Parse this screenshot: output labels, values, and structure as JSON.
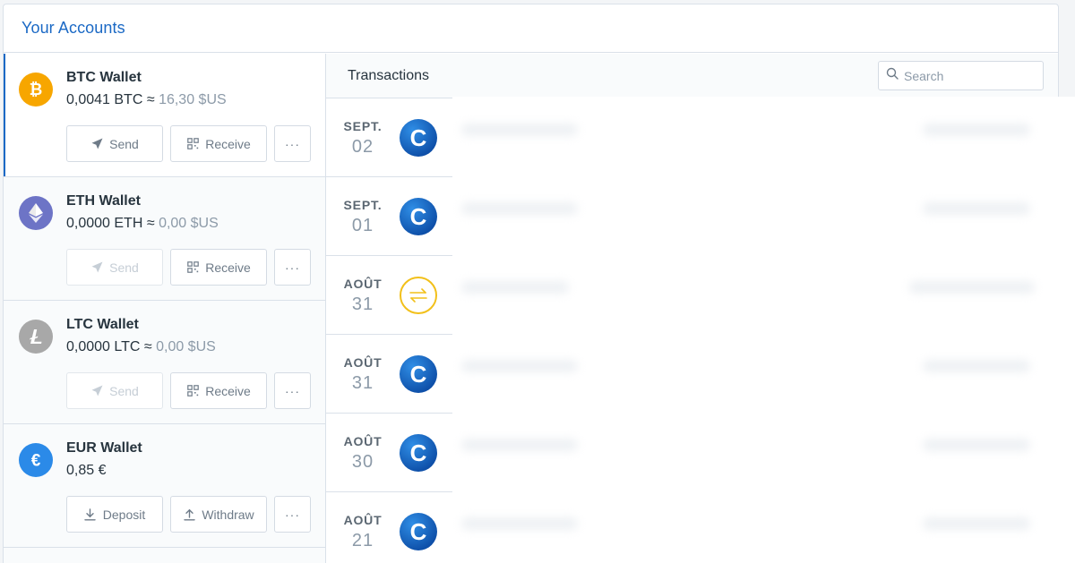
{
  "panel": {
    "title": "Your Accounts"
  },
  "accounts": [
    {
      "name": "BTC Wallet",
      "amount": "0,0041 BTC ≈ ",
      "fiat": "16,30 $US",
      "icon": "bitcoin-icon",
      "color": "#f7a600",
      "actions": [
        {
          "label": "Send",
          "icon": "send-icon",
          "disabled": false
        },
        {
          "label": "Receive",
          "icon": "qr-code-icon",
          "disabled": false
        }
      ]
    },
    {
      "name": "ETH Wallet",
      "amount": "0,0000 ETH ≈ ",
      "fiat": "0,00 $US",
      "icon": "ethereum-icon",
      "color": "#6d74c6",
      "actions": [
        {
          "label": "Send",
          "icon": "send-icon",
          "disabled": true
        },
        {
          "label": "Receive",
          "icon": "qr-code-icon",
          "disabled": false
        }
      ]
    },
    {
      "name": "LTC Wallet",
      "amount": "0,0000 LTC ≈ ",
      "fiat": "0,00 $US",
      "icon": "litecoin-icon",
      "color": "#a8a8a8",
      "actions": [
        {
          "label": "Send",
          "icon": "send-icon",
          "disabled": true
        },
        {
          "label": "Receive",
          "icon": "qr-code-icon",
          "disabled": false
        }
      ]
    },
    {
      "name": "EUR Wallet",
      "amount": "0,85 €",
      "fiat": "",
      "icon": "euro-icon",
      "color": "#2b8ae8",
      "actions": [
        {
          "label": "Deposit",
          "icon": "deposit-icon",
          "disabled": false
        },
        {
          "label": "Withdraw",
          "icon": "withdraw-icon",
          "disabled": false
        }
      ]
    }
  ],
  "more_label": "···",
  "transactions": {
    "title": "Transactions",
    "search_placeholder": "Search",
    "rows": [
      {
        "month": "SEPT.",
        "day": "02",
        "icon": "coinbase-icon"
      },
      {
        "month": "SEPT.",
        "day": "01",
        "icon": "coinbase-icon"
      },
      {
        "month": "AOÛT",
        "day": "31",
        "icon": "convert-icon"
      },
      {
        "month": "AOÛT",
        "day": "31",
        "icon": "coinbase-icon"
      },
      {
        "month": "AOÛT",
        "day": "30",
        "icon": "coinbase-icon"
      },
      {
        "month": "AOÛT",
        "day": "21",
        "icon": "coinbase-icon"
      }
    ]
  },
  "coinbase_glyph": "C",
  "colors": {
    "accent": "#1b69c5",
    "convert": "#f2c01a"
  }
}
